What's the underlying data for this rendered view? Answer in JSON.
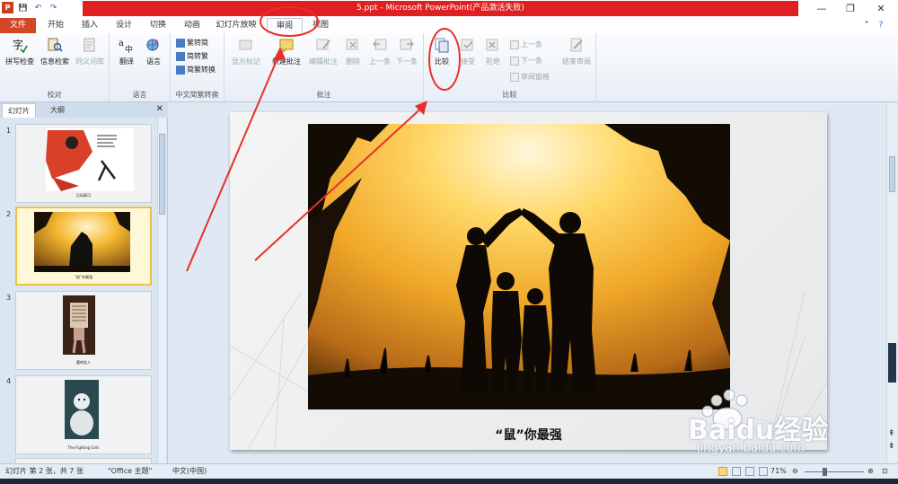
{
  "window": {
    "title": "5.ppt - Microsoft PowerPoint(产品激活失败)",
    "minimize": "—",
    "restore": "❐",
    "close": "✕"
  },
  "qat": {
    "save": "💾",
    "undo": "↶",
    "redo": "↷"
  },
  "tabs": [
    "文件",
    "开始",
    "插入",
    "设计",
    "切换",
    "动画",
    "幻灯片放映",
    "审阅",
    "视图"
  ],
  "ribbon": {
    "proofing": {
      "label": "校对",
      "spell": "拼写检查",
      "research": "信息检索",
      "thesaurus": "同义词库"
    },
    "language": {
      "label": "语言",
      "translate": "翻译",
      "language": "语言"
    },
    "chinese": {
      "label": "中文简繁转换",
      "to_simp": "繁转简",
      "to_trad": "简转繁",
      "convert": "简繁转换"
    },
    "comments": {
      "label": "批注",
      "show_markup": "显示标记",
      "new": "新建批注",
      "edit": "编辑批注",
      "delete": "删除",
      "prev": "上一条",
      "next": "下一条"
    },
    "compare": {
      "label": "比较",
      "compare": "比较",
      "accept": "接受",
      "reject": "拒绝",
      "prev": "上一条",
      "next": "下一条",
      "pane": "审阅窗格",
      "end": "结束审阅"
    }
  },
  "pane": {
    "tab_slides": "幻灯片",
    "tab_outline": "大纲",
    "close": "✕",
    "slides": [
      {
        "num": "1",
        "caption": "后妈真可"
      },
      {
        "num": "2",
        "caption": "“鼠”你最强"
      },
      {
        "num": "3",
        "caption": "腰带女人"
      },
      {
        "num": "4",
        "caption": "The Fighting Girls"
      }
    ]
  },
  "slide": {
    "title": "“鼠”你最强"
  },
  "status": {
    "slide_info": "幻灯片 第 2 张，共 7 张",
    "theme": "\"Office 主题\"",
    "language": "中文(中国)",
    "zoom": "71%"
  },
  "watermark": {
    "brand": "Baidu经验",
    "url": "jingyan.baidu.com"
  },
  "colors": {
    "title_red": "#e02020",
    "file_tab": "#d24726",
    "annotation": "#e8302a"
  }
}
